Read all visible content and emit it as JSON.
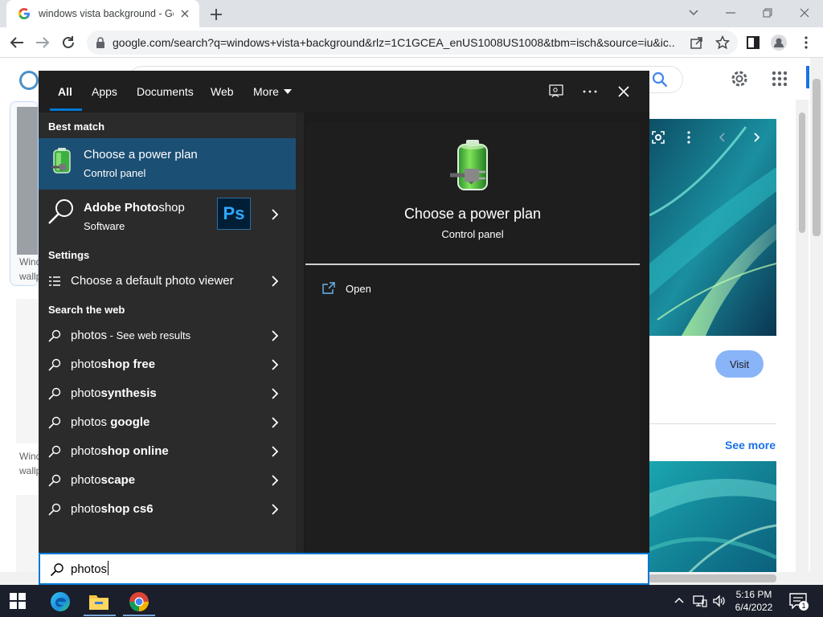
{
  "browser": {
    "tab_title": "windows vista background - Google Search",
    "url": "google.com/search?q=windows+vista+background&rlz=1C1GCEA_enUS1008US1008&tbm=isch&source=iu&ic..."
  },
  "google_page": {
    "visit_label": "Visit",
    "see_more_label": "See more",
    "result_1_title": "Windows",
    "result_1_source": "wallpa",
    "result_2_title": "Windows",
    "result_2_source": "wallpa"
  },
  "search_panel": {
    "tabs": [
      {
        "label": "All",
        "active": true
      },
      {
        "label": "Apps"
      },
      {
        "label": "Documents"
      },
      {
        "label": "Web"
      },
      {
        "label": "More"
      }
    ],
    "best_match_header": "Best match",
    "best_match": {
      "title": "Choose a power plan",
      "subtitle": "Control panel"
    },
    "app_result": {
      "title_bold": "Adobe Photo",
      "title_normal": "shop",
      "subtitle": "Software",
      "badge": "Ps"
    },
    "settings_header": "Settings",
    "settings_item": "Choose a default photo viewer",
    "web_header": "Search the web",
    "web_results": [
      {
        "typed": "photos",
        "rest": "",
        "suffix": " - See web results"
      },
      {
        "typed": "photo",
        "rest": "shop free",
        "suffix": ""
      },
      {
        "typed": "photo",
        "rest": "synthesis",
        "suffix": ""
      },
      {
        "typed": "photos",
        "rest": " google",
        "suffix": ""
      },
      {
        "typed": "photo",
        "rest": "shop online",
        "suffix": ""
      },
      {
        "typed": "photo",
        "rest": "scape",
        "suffix": ""
      },
      {
        "typed": "photo",
        "rest": "shop cs6",
        "suffix": ""
      }
    ],
    "preview": {
      "title": "Choose a power plan",
      "subtitle": "Control panel",
      "action_open": "Open"
    },
    "query": "photos"
  },
  "taskbar": {
    "time": "5:16 PM",
    "date": "6/4/2022",
    "notification_count": "1"
  },
  "colors": {
    "panel_bg": "#2b2b2b",
    "header_bg": "#1f1f1f",
    "selected_bg": "#1c4f74",
    "accent": "#0078d4",
    "taskbar_bg": "#1a1f2b"
  }
}
